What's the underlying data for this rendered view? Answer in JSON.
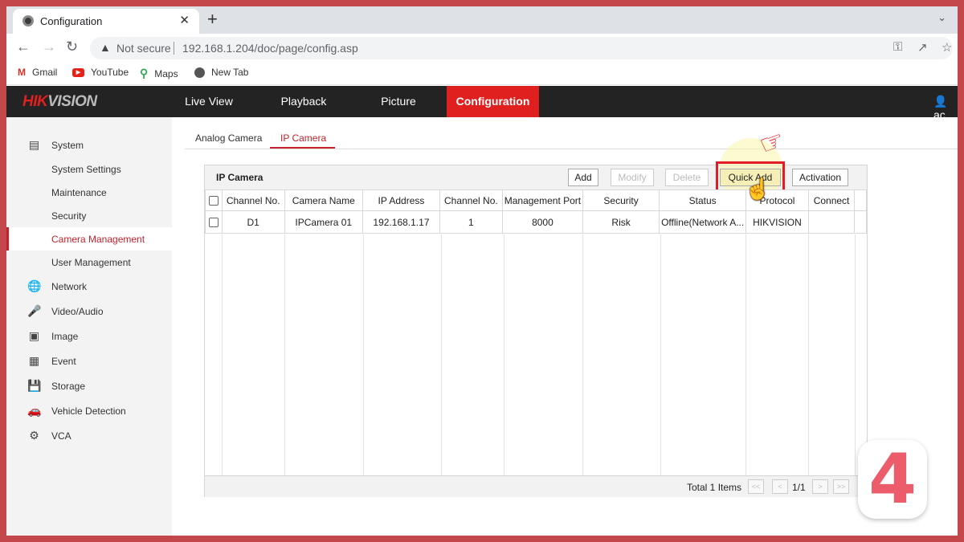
{
  "browser": {
    "tab_title": "Configuration",
    "tab_close": "✕",
    "new_tab": "+",
    "not_secure": "Not secure",
    "url": "192.168.1.204/doc/page/config.asp",
    "bookmarks": [
      {
        "label": "Gmail",
        "icon": "gmail-icon"
      },
      {
        "label": "YouTube",
        "icon": "youtube-icon"
      },
      {
        "label": "Maps",
        "icon": "maps-icon"
      },
      {
        "label": "New Tab",
        "icon": "globe-icon"
      }
    ]
  },
  "app": {
    "logo_part1": "HIK",
    "logo_part2": "VISION",
    "nav": [
      "Live View",
      "Playback",
      "Picture",
      "Configuration"
    ],
    "active_nav": "Configuration",
    "user": "ac",
    "accent": "#e0201f"
  },
  "sidebar": {
    "items": [
      {
        "label": "System",
        "icon": "system-icon",
        "level": "main"
      },
      {
        "label": "System Settings",
        "level": "sub"
      },
      {
        "label": "Maintenance",
        "level": "sub"
      },
      {
        "label": "Security",
        "level": "sub"
      },
      {
        "label": "Camera Management",
        "level": "sub",
        "active": true
      },
      {
        "label": "User Management",
        "level": "sub"
      },
      {
        "label": "Network",
        "icon": "network-icon",
        "level": "main"
      },
      {
        "label": "Video/Audio",
        "icon": "microphone-icon",
        "level": "main"
      },
      {
        "label": "Image",
        "icon": "image-icon",
        "level": "main"
      },
      {
        "label": "Event",
        "icon": "calendar-icon",
        "level": "main"
      },
      {
        "label": "Storage",
        "icon": "disk-icon",
        "level": "main"
      },
      {
        "label": "Vehicle Detection",
        "icon": "vehicle-icon",
        "level": "main"
      },
      {
        "label": "VCA",
        "icon": "vca-icon",
        "level": "main"
      }
    ]
  },
  "subtabs": [
    "Analog Camera",
    "IP Camera"
  ],
  "panel": {
    "title": "IP Camera",
    "buttons": {
      "add": "Add",
      "modify": "Modify",
      "delete": "Delete",
      "quick_add": "Quick Add",
      "activation": "Activation"
    },
    "columns": [
      "Channel No.",
      "Camera Name",
      "IP Address",
      "Channel No.",
      "Management Port",
      "Security",
      "Status",
      "Protocol",
      "Connect"
    ],
    "rows": [
      [
        "D1",
        "IPCamera 01",
        "192.168.1.17",
        "1",
        "8000",
        "Risk",
        "Offline(Network A...",
        "HIKVISION",
        ""
      ]
    ],
    "total": "Total 1 Items",
    "pager": {
      "first": "<<",
      "prev": "<",
      "page": "1/1",
      "next": ">",
      "last": ">>"
    }
  },
  "overlay": {
    "badge_number": "4"
  }
}
